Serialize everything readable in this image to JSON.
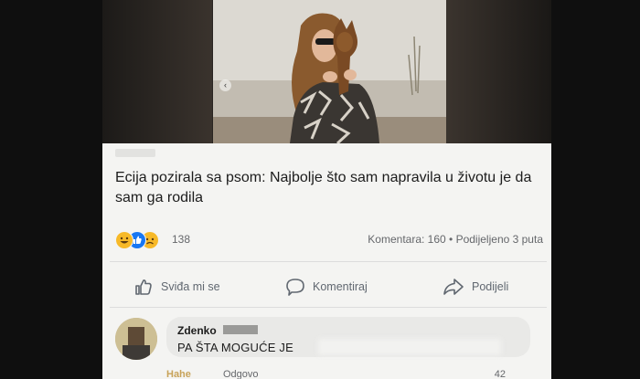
{
  "post": {
    "headline": "Ecija pozirala sa psom: Najbolje što sam napravila u životu je da sam ga rodila",
    "photo_nav_icon": "carousel-dot-icon"
  },
  "stats": {
    "reaction_count": "138",
    "comments": "Komentara: 160",
    "separator": "•",
    "shares": "Podijeljeno 3 puta",
    "reaction_icons": [
      "laugh-emoji-icon",
      "like-thumb-icon",
      "sad-emoji-icon"
    ]
  },
  "actions": {
    "like_label": "Sviđa mi se",
    "comment_label": "Komentiraj",
    "share_label": "Podijeli"
  },
  "comment": {
    "author": "Zdenko",
    "text": "PA ŠTA MOGUĆE JE",
    "like_label": "Hahe",
    "reply_label": "Odgovo",
    "reaction_count": "42"
  },
  "colors": {
    "background": "#141414",
    "screen": "#f4f4f2",
    "text": "#1c1c1c",
    "muted": "#65676b",
    "like_blue": "#1877f2",
    "haha_yellow": "#f7b928"
  }
}
